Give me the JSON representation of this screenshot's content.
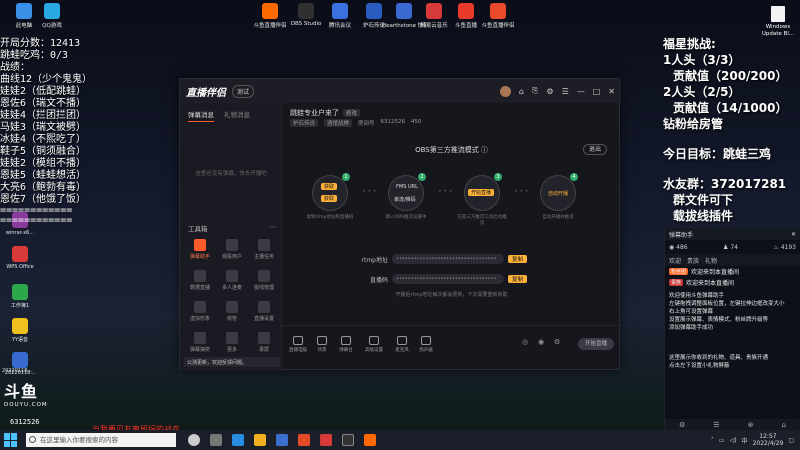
{
  "desktop": {
    "top_icons": [
      {
        "label": "此电脑",
        "color": "#3a8ee6"
      },
      {
        "label": "QQ游戏",
        "color": "#2aa8e0"
      },
      {
        "label": "斗鱼直播伴侣",
        "color": "#ff6a00"
      },
      {
        "label": "OBS Studio",
        "color": "#303030"
      },
      {
        "label": "腾讯会议",
        "color": "#3a70e0"
      },
      {
        "label": "炉石传说",
        "color": "#2a5cc0"
      },
      {
        "label": "Hearthstone 快捷方式",
        "color": "#3a6ad0"
      },
      {
        "label": "网易云音乐",
        "color": "#d83a3a"
      },
      {
        "label": "斗鱼直播",
        "color": "#e83a2a"
      },
      {
        "label": "斗鱼直播伴侣",
        "color": "#e84a2a"
      }
    ],
    "left_icons": [
      {
        "label": "winrar-x6...",
        "color": "#8a3a9a"
      },
      {
        "label": "WPS Office",
        "color": "#d83a3a"
      },
      {
        "label": "工作簿1",
        "color": "#2aa84a"
      },
      {
        "label": "YY语音",
        "color": "#f0c020"
      },
      {
        "label": "20220118...",
        "color": "#3a6ad0"
      }
    ],
    "win_update": "Windows Update Bl..."
  },
  "left_overlay": {
    "lines": [
      "开局分数：12413",
      "跳蛙吃鸡：0/3",
      "战绩：",
      "曲线12（少个鬼鬼）",
      "娃娃2（低配跳蛙）",
      "恩佐6（瑞文不播）",
      "娃娃4（拦团拦团）",
      "马娃3（瑞文被劈）",
      "冰娃4（不熙吃了）",
      "鞋子5（铜须融合）",
      "娃娃2（模组不播）",
      "恩娃5（蛙蛙想活）",
      "大亮6（鲍勃有毒）",
      "恩佐7（他饿了饭）"
    ],
    "separators": [
      "============",
      "============"
    ]
  },
  "right_overlay": {
    "title": "福星挑战:",
    "task1": "1人头（3/3）",
    "task1_sub": "贡献值（200/200）",
    "task2": "2人头（2/5）",
    "task2_sub": "贡献值（14/1000）",
    "reward": "钻粉给房管",
    "goal": "今日目标：跳蛙三鸡",
    "group": "水友群：372017281",
    "group_sub1": "群文件可下",
    "group_sub2": "载拔线插件"
  },
  "chat": {
    "title": "弹幕助手",
    "stat1": "486",
    "stat2": "74",
    "stat3": "4193",
    "tabs": [
      "欢迎",
      "贵族",
      "礼物"
    ],
    "rows": [
      {
        "badge": "粉丝团",
        "badge_color": "#ff6a2a",
        "text": "欢迎来到本直播间"
      },
      {
        "badge": "贵族",
        "badge_color": "#c83a3a",
        "text": "欢迎来到本直播间"
      }
    ],
    "msg": "欢迎使用斗鱼弹幕助手\n左键拖拽调整面板位置，左键拉伸边框改变大小\n右上角可设置弹幕\n设置展示弹幕、表情模式、粉丝牌升级等\n添加弹幕助手成功",
    "msg2": "这里展示你收到的礼物、道具、贵族开通\n点击左下设置小礼物屏蔽"
  },
  "app": {
    "logo": "直播伴侣",
    "version": "测试",
    "title_icons": [
      "⌂",
      "⎘",
      "⚙",
      "☰",
      "—",
      "□",
      "✕"
    ],
    "sidebar": {
      "tabs": [
        "弹幕消息",
        "礼物消息"
      ],
      "empty": "这里还没有弹幕，快去开播吧",
      "tools_title": "工具箱",
      "tools_more": "⋯",
      "tools": [
        {
          "label": "弹幕助手",
          "active": true
        },
        {
          "label": "观看用户",
          "active": false
        },
        {
          "label": "主播任务",
          "active": false
        },
        {
          "label": "数据直播",
          "active": false
        },
        {
          "label": "多人连麦",
          "active": false
        },
        {
          "label": "拔线管理",
          "active": false
        },
        {
          "label": "虚拟形象",
          "active": false
        },
        {
          "label": "房管",
          "active": false
        },
        {
          "label": "直播设置",
          "active": false
        },
        {
          "label": "弹幕抽奖",
          "active": false
        },
        {
          "label": "更多",
          "active": false
        },
        {
          "label": "录屏",
          "active": false
        }
      ],
      "notice": "公测更新，欢迎反馈问题。"
    },
    "main": {
      "room_title": "跳蛙专业户来了",
      "edit": "修改",
      "tags": [
        "炉石传说",
        "酒馆战棋",
        "房间号",
        "6312526",
        "450"
      ],
      "mode_title": "OBS第三方推流模式",
      "exit": "退出",
      "steps": [
        {
          "num": "1",
          "btn1": "获取",
          "btn2": "获取",
          "desc": "复制rtmp地址和直播码"
        },
        {
          "num": "2",
          "text1": "FMS URL",
          "text2": "串流/推码",
          "desc": "填入OBS推流设置中"
        },
        {
          "num": "3",
          "btn": "开始直播",
          "desc": "在第三方推流工具启动推流"
        },
        {
          "num": "4",
          "text": "自动开播",
          "desc": "自动开播并推流"
        }
      ],
      "rtmp_label": "rtmp地址",
      "rtmp_value": "••••••••••••••••••••••••••••••••••",
      "code_label": "直播码",
      "code_value": "••••••••••••••••••••••••••••••••••",
      "copy": "复制",
      "hint": "开播后rtmp地址每次都会更新，下次需要重新获取",
      "bottom_items": [
        "直播电脑",
        "场景",
        "弹幕台",
        "高级设置",
        "麦克风",
        "扬声器"
      ],
      "start": "开始直播"
    }
  },
  "overlay_bottom": {
    "logo": "斗鱼",
    "url": "DOUYU.COM",
    "room": "6312526",
    "danmu": "当我要见友离留拐的战衣",
    "date": "20220118..."
  },
  "taskbar": {
    "search": "在这里输入你要搜索的内容",
    "time": "12:57",
    "date": "2022/4/29",
    "ime": "中"
  }
}
